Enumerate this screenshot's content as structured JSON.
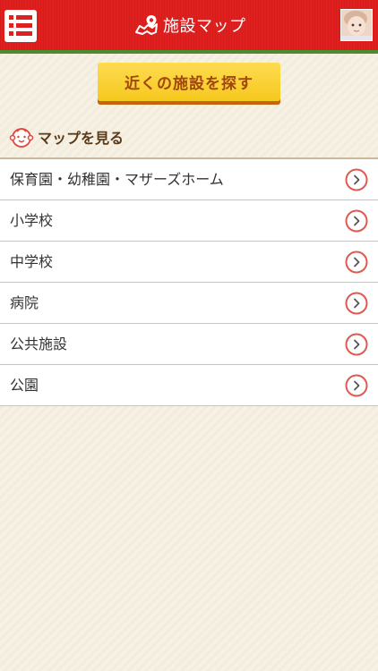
{
  "header": {
    "title": "施設マップ",
    "menu_icon": "list-menu-icon",
    "title_icon": "map-pin-icon",
    "avatar_icon": "baby-photo-avatar",
    "colors": {
      "bar": "#e0201e",
      "accent_line": "#4e8a2e"
    }
  },
  "near_button": {
    "label": "近くの施設を探す",
    "colors": {
      "fill": "#fcd337",
      "text": "#a0480c"
    }
  },
  "section": {
    "title": "マップを見る",
    "icon": "baby-face-icon"
  },
  "facilities": [
    {
      "label": "保育園・幼稚園・マザーズホーム"
    },
    {
      "label": "小学校"
    },
    {
      "label": "中学校"
    },
    {
      "label": "病院"
    },
    {
      "label": "公共施設"
    },
    {
      "label": "公園"
    }
  ],
  "chevron": {
    "icon": "chevron-right-circle-icon",
    "color": "#e05a52"
  }
}
